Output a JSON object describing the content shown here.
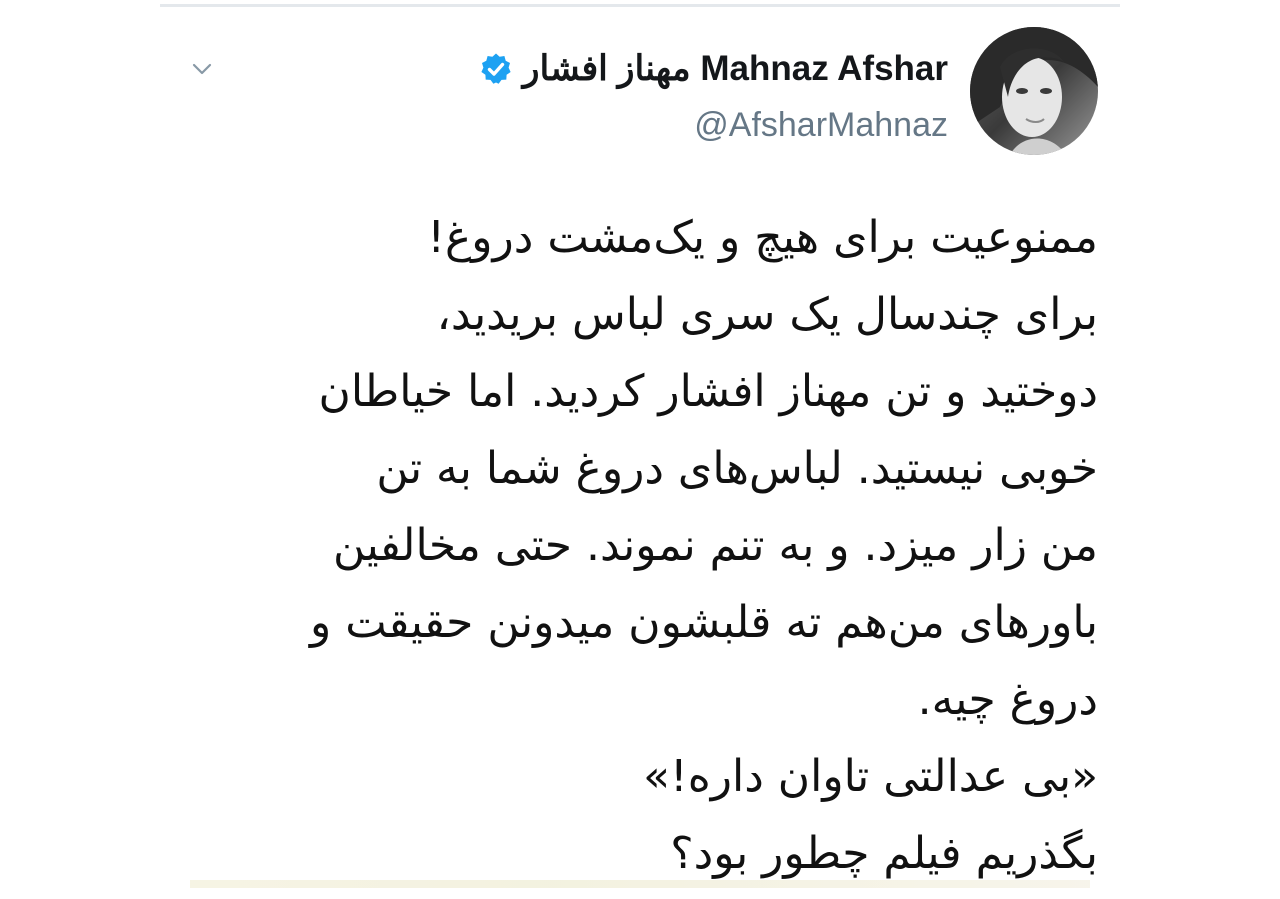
{
  "tweet": {
    "author_name": "مهناز افشار Mahnaz Afshar",
    "handle": "@AfsharMahnaz",
    "verified": true,
    "body_lines": [
      "ممنوعیت برای هیچ و یک‌مشت دروغ!",
      "برای چندسال یک سری لباس بریدید،",
      "دوختید و تن مهناز افشار کردید. اما خیاطان",
      "خوبی نیستید. لباس‌های دروغ شما به تن",
      "من زار میزد. و به تنم نموند. حتی مخالفین",
      "باورهای من‌هم ته قلبشون میدونن حقیقت و",
      "دروغ چیه.",
      "«بی عدالتی تاوان داره!»",
      "بگذریم فیلم چطور بود؟"
    ]
  },
  "icons": {
    "menu": "chevron-down-icon",
    "verified": "verified-badge-icon",
    "avatar": "avatar"
  },
  "colors": {
    "verified_blue": "#1da1f2",
    "name_text": "#14171a",
    "handle_text": "#657786",
    "body_text": "#111111"
  }
}
